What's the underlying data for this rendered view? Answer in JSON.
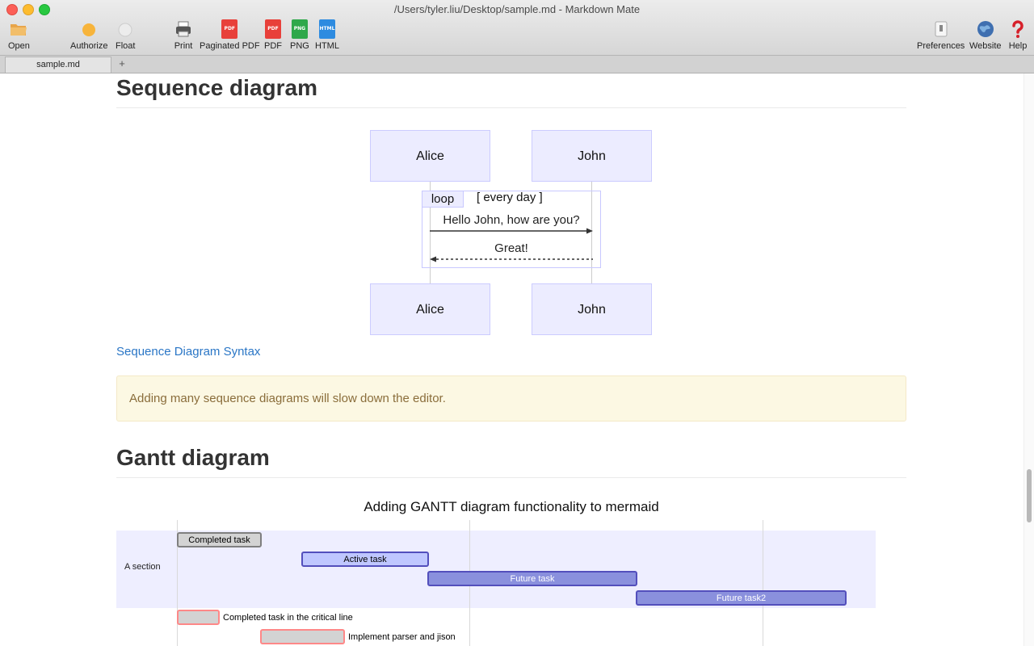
{
  "window": {
    "title": "/Users/tyler.liu/Desktop/sample.md - Markdown Mate"
  },
  "toolbar": {
    "open": "Open",
    "authorize": "Authorize",
    "float": "Float",
    "print": "Print",
    "paginated_pdf": "Paginated PDF",
    "pdf": "PDF",
    "png": "PNG",
    "html": "HTML",
    "preferences": "Preferences",
    "website": "Website",
    "help": "Help",
    "icon_text": {
      "pdf": "PDF",
      "png": "PNG",
      "html": "HTML"
    }
  },
  "tabs": {
    "active": "sample.md",
    "add": "+"
  },
  "sequence": {
    "heading": "Sequence diagram",
    "actors": [
      "Alice",
      "John"
    ],
    "loop_label": "loop",
    "loop_condition": "[ every day ]",
    "messages": [
      "Hello John, how are you?",
      "Great!"
    ],
    "link": "Sequence Diagram Syntax",
    "note": "Adding many sequence diagrams will slow down the editor."
  },
  "gantt": {
    "heading": "Gantt diagram",
    "title": "Adding GANTT diagram functionality to mermaid",
    "section": "A section",
    "tasks": {
      "completed": "Completed task",
      "active": "Active task",
      "future": "Future task",
      "future2": "Future task2",
      "crit_completed": "Completed task in the critical line",
      "parser": "Implement parser and jison"
    }
  },
  "colors": {
    "accent_link": "#2a76c6",
    "note_bg": "#fcf8e3",
    "note_text": "#8a6d3b",
    "actor_fill": "#ececff",
    "active_bar": "#bfc7ff",
    "future_bar": "#8a90dd",
    "critical_border": "#ff8888"
  }
}
